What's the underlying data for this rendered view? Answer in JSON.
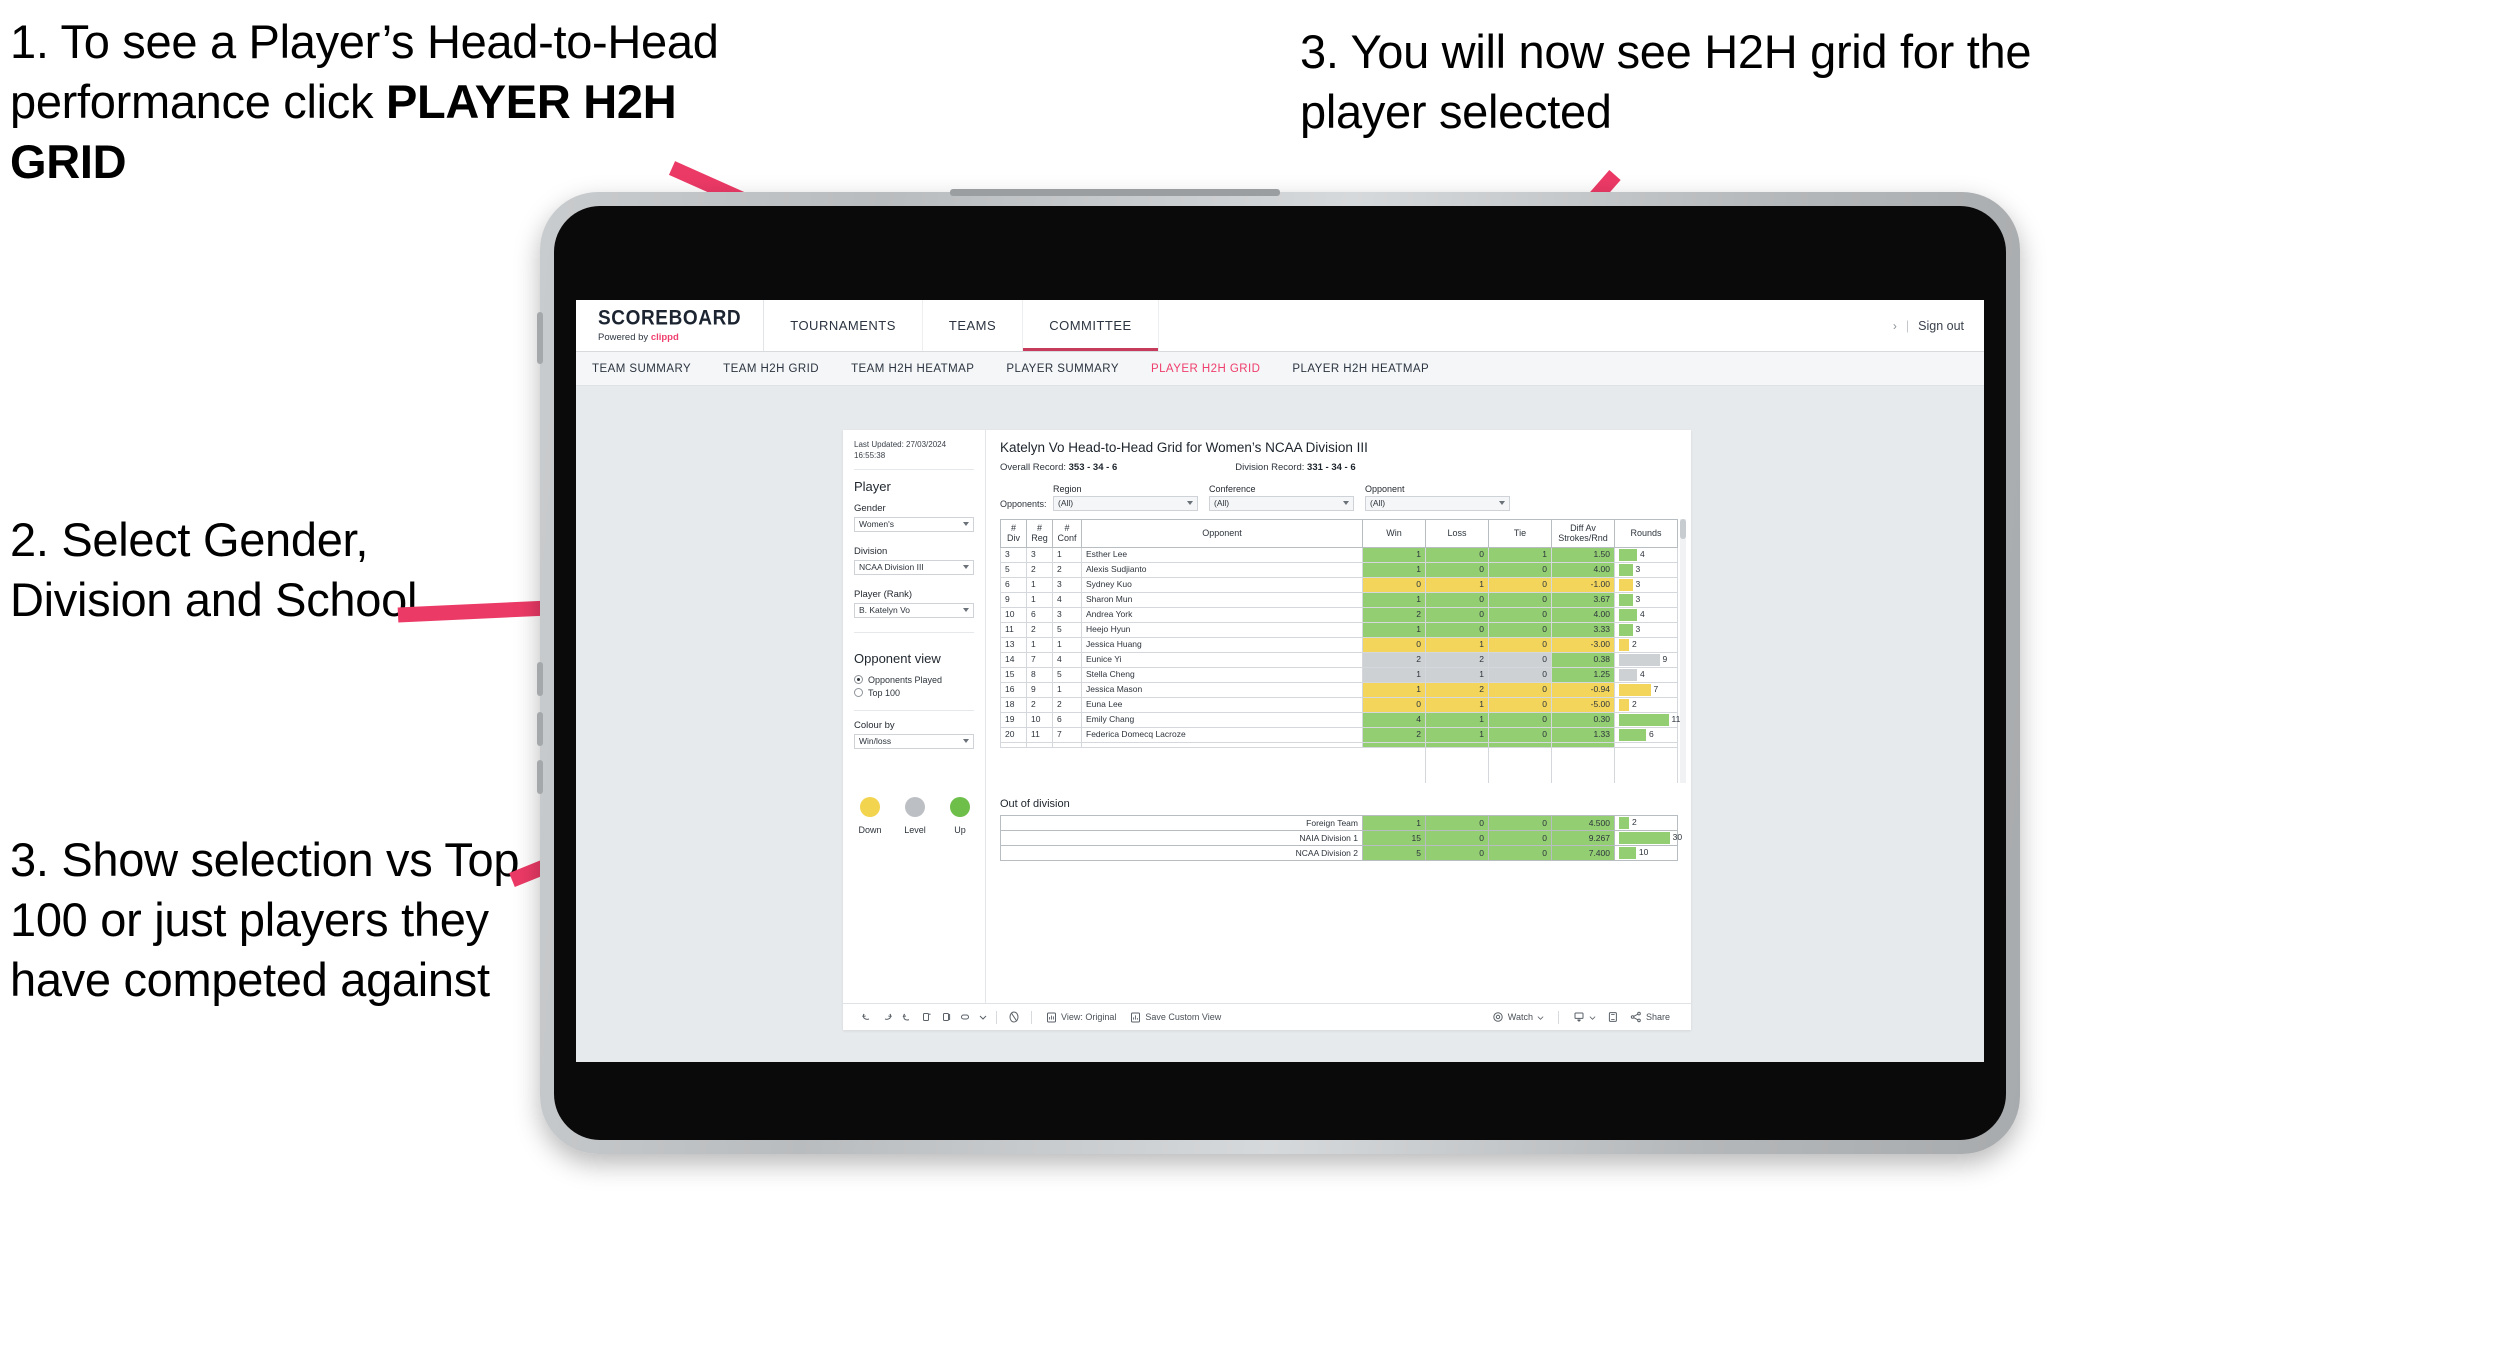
{
  "slide": {
    "callouts": [
      {
        "id": "c1",
        "prefix": "1. To see a Player’s Head-to-Head performance click ",
        "bold": "PLAYER H2H GRID"
      },
      {
        "id": "c2",
        "text": "2. Select Gender, Division and School"
      },
      {
        "id": "c3",
        "text": "3. Show selection vs Top 100 or just players they have competed against"
      },
      {
        "id": "c4",
        "text": "3. You will now see H2H grid for the player selected"
      }
    ],
    "arrow_color": "#ec3a66"
  },
  "topbar": {
    "brand_title": "SCOREBOARD",
    "brand_sub_prefix": "Powered by ",
    "brand_sub_accent": "clippd",
    "nav": [
      {
        "label": "TOURNAMENTS",
        "active": false
      },
      {
        "label": "TEAMS",
        "active": false
      },
      {
        "label": "COMMITTEE",
        "active": true
      }
    ],
    "chevron": "›",
    "pipe": "|",
    "signout": "Sign out"
  },
  "subnav": {
    "items": [
      {
        "label": "TEAM SUMMARY",
        "active": false
      },
      {
        "label": "TEAM H2H GRID",
        "active": false
      },
      {
        "label": "TEAM H2H HEATMAP",
        "active": false
      },
      {
        "label": "PLAYER SUMMARY",
        "active": false
      },
      {
        "label": "PLAYER H2H GRID",
        "active": true
      },
      {
        "label": "PLAYER H2H HEATMAP",
        "active": false
      }
    ],
    "active_color": "#ef3e6d"
  },
  "filters": {
    "last_updated": "Last Updated: 27/03/2024 16:55:38",
    "player_heading": "Player",
    "gender_label": "Gender",
    "gender_value": "Women's",
    "division_label": "Division",
    "division_value": "NCAA Division III",
    "player_rank_label": "Player (Rank)",
    "player_rank_value": "B. Katelyn Vo",
    "opponent_view_heading": "Opponent view",
    "radio_options": [
      {
        "label": "Opponents Played",
        "checked": true
      },
      {
        "label": "Top 100",
        "checked": false
      }
    ],
    "colour_by_label": "Colour by",
    "colour_by_value": "Win/loss",
    "legend": [
      {
        "label": "Down",
        "color": "#f2d44e"
      },
      {
        "label": "Level",
        "color": "#bcc0c4"
      },
      {
        "label": "Up",
        "color": "#6ebe4a"
      }
    ]
  },
  "grid": {
    "title": "Katelyn Vo Head-to-Head Grid for Women’s NCAA Division III",
    "overall_record_label": "Overall Record: ",
    "overall_record_value": "353 -  34 - 6",
    "division_record_label": "Division Record: ",
    "division_record_value": "331 -  34 - 6",
    "opponents_label": "Opponents:",
    "opponent_filters": [
      {
        "label": "Region",
        "value": "(All)"
      },
      {
        "label": "Conference",
        "value": "(All)"
      },
      {
        "label": "Opponent",
        "value": "(All)"
      }
    ],
    "columns": [
      {
        "line1": "#",
        "line2": "Div"
      },
      {
        "line1": "#",
        "line2": "Reg"
      },
      {
        "line1": "#",
        "line2": "Conf"
      },
      {
        "line1": "Opponent",
        "line2": ""
      },
      {
        "line1": "Win",
        "line2": ""
      },
      {
        "line1": "Loss",
        "line2": ""
      },
      {
        "line1": "Tie",
        "line2": ""
      },
      {
        "line1": "Diff Av",
        "line2": "Strokes/Rnd"
      },
      {
        "line1": "Rounds",
        "line2": ""
      }
    ],
    "colors": {
      "up": "#93ce72",
      "down": "#f3d55c",
      "level": "#cdd1d4"
    },
    "rows": [
      {
        "div": "3",
        "reg": "3",
        "conf": "1",
        "opponent": "Esther Lee",
        "win": "1",
        "loss": "0",
        "tie": "1",
        "diff": "1.50",
        "rounds": 4,
        "state": "up"
      },
      {
        "div": "5",
        "reg": "2",
        "conf": "2",
        "opponent": "Alexis Sudjianto",
        "win": "1",
        "loss": "0",
        "tie": "0",
        "diff": "4.00",
        "rounds": 3,
        "state": "up"
      },
      {
        "div": "6",
        "reg": "1",
        "conf": "3",
        "opponent": "Sydney Kuo",
        "win": "0",
        "loss": "1",
        "tie": "0",
        "diff": "-1.00",
        "rounds": 3,
        "state": "down"
      },
      {
        "div": "9",
        "reg": "1",
        "conf": "4",
        "opponent": "Sharon Mun",
        "win": "1",
        "loss": "0",
        "tie": "0",
        "diff": "3.67",
        "rounds": 3,
        "state": "up"
      },
      {
        "div": "10",
        "reg": "6",
        "conf": "3",
        "opponent": "Andrea York",
        "win": "2",
        "loss": "0",
        "tie": "0",
        "diff": "4.00",
        "rounds": 4,
        "state": "up"
      },
      {
        "div": "11",
        "reg": "2",
        "conf": "5",
        "opponent": "Heejo Hyun",
        "win": "1",
        "loss": "0",
        "tie": "0",
        "diff": "3.33",
        "rounds": 3,
        "state": "up"
      },
      {
        "div": "13",
        "reg": "1",
        "conf": "1",
        "opponent": "Jessica Huang",
        "win": "0",
        "loss": "1",
        "tie": "0",
        "diff": "-3.00",
        "rounds": 2,
        "state": "down"
      },
      {
        "div": "14",
        "reg": "7",
        "conf": "4",
        "opponent": "Eunice Yi",
        "win": "2",
        "loss": "2",
        "tie": "0",
        "diff": "0.38",
        "rounds": 9,
        "state": "level",
        "diff_state": "up"
      },
      {
        "div": "15",
        "reg": "8",
        "conf": "5",
        "opponent": "Stella Cheng",
        "win": "1",
        "loss": "1",
        "tie": "0",
        "diff": "1.25",
        "rounds": 4,
        "state": "level",
        "diff_state": "up"
      },
      {
        "div": "16",
        "reg": "9",
        "conf": "1",
        "opponent": "Jessica Mason",
        "win": "1",
        "loss": "2",
        "tie": "0",
        "diff": "-0.94",
        "rounds": 7,
        "state": "down"
      },
      {
        "div": "18",
        "reg": "2",
        "conf": "2",
        "opponent": "Euna Lee",
        "win": "0",
        "loss": "1",
        "tie": "0",
        "diff": "-5.00",
        "rounds": 2,
        "state": "down"
      },
      {
        "div": "19",
        "reg": "10",
        "conf": "6",
        "opponent": "Emily Chang",
        "win": "4",
        "loss": "1",
        "tie": "0",
        "diff": "0.30",
        "rounds": 11,
        "state": "up"
      },
      {
        "div": "20",
        "reg": "11",
        "conf": "7",
        "opponent": "Federica Domecq Lacroze",
        "win": "2",
        "loss": "1",
        "tie": "0",
        "diff": "1.33",
        "rounds": 6,
        "state": "up"
      }
    ],
    "rounds_max": 12,
    "out_of_division_title": "Out of division",
    "out_of_division_rows": [
      {
        "label": "Foreign Team",
        "win": "1",
        "loss": "0",
        "tie": "0",
        "diff": "4.500",
        "rounds": 2,
        "state": "up"
      },
      {
        "label": "NAIA Division 1",
        "win": "15",
        "loss": "0",
        "tie": "0",
        "diff": "9.267",
        "rounds": 30,
        "state": "up"
      },
      {
        "label": "NCAA Division 2",
        "win": "5",
        "loss": "0",
        "tie": "0",
        "diff": "7.400",
        "rounds": 10,
        "state": "up"
      }
    ],
    "out_of_division_rounds_max": 32
  },
  "toolbar": {
    "view_label": "View: Original",
    "save_label": "Save Custom View",
    "watch_label": "Watch",
    "share_label": "Share"
  }
}
